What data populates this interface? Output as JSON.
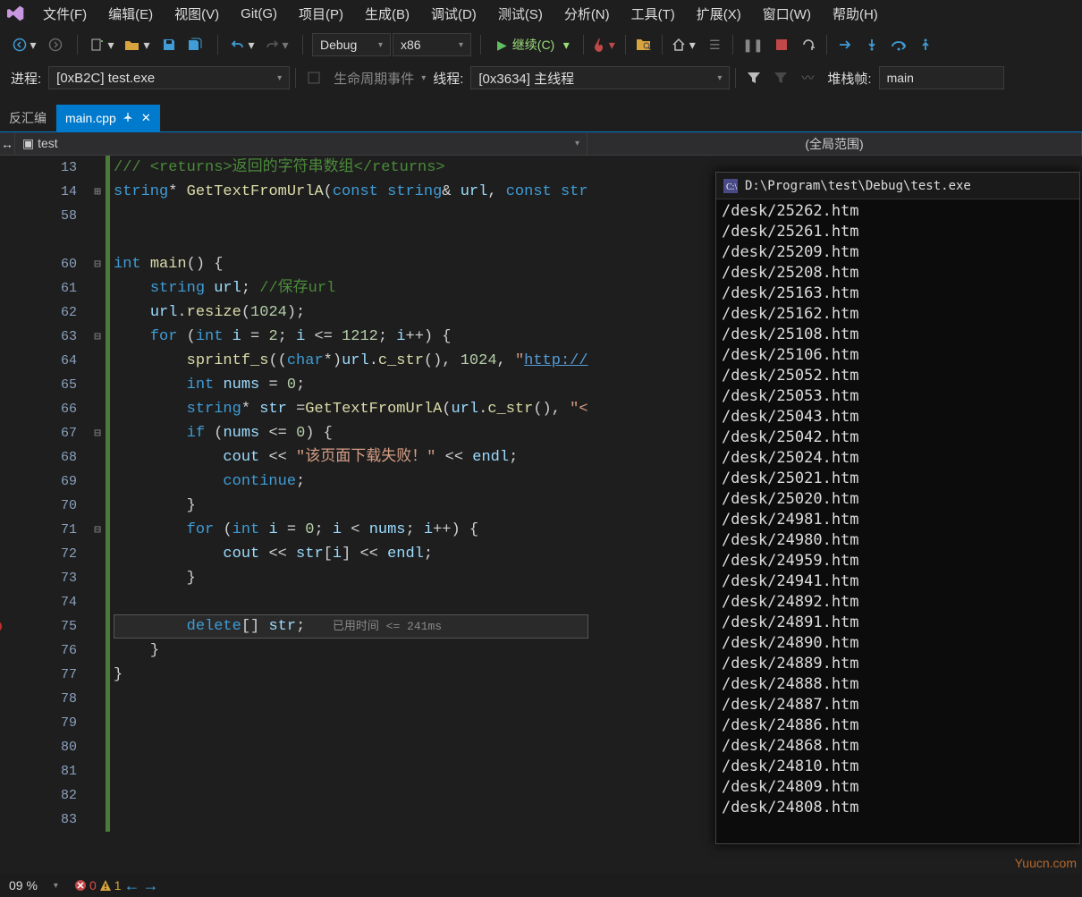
{
  "menu": {
    "items": [
      "文件(F)",
      "编辑(E)",
      "视图(V)",
      "Git(G)",
      "项目(P)",
      "生成(B)",
      "调试(D)",
      "测试(S)",
      "分析(N)",
      "工具(T)",
      "扩展(X)",
      "窗口(W)",
      "帮助(H)"
    ]
  },
  "toolbar1": {
    "config_combo": "Debug",
    "platform_combo": "x86",
    "continue_label": "继续(C)"
  },
  "toolbar2": {
    "process_label": "进程:",
    "process_value": "[0xB2C] test.exe",
    "lifecycle_label": "生命周期事件",
    "thread_label": "线程:",
    "thread_value": "[0x3634] 主线程",
    "stackframe_label": "堆栈帧:",
    "stackframe_value": "main"
  },
  "tabs": {
    "items": [
      {
        "label": "反汇编",
        "active": false
      },
      {
        "label": "main.cpp",
        "active": true
      }
    ]
  },
  "scope": {
    "project_combo": "test",
    "scope_combo": "(全局范围)"
  },
  "code": {
    "lines": [
      {
        "n": 13,
        "fold": "",
        "html": "<span class='c-cm'>/// &lt;returns&gt;返回的字符串数组&lt;/returns&gt;</span>"
      },
      {
        "n": 14,
        "fold": "+",
        "html": "<span class='c-ty'>string</span><span class='c-op'>* </span><span class='c-fn'>GetTextFromUrlA</span><span class='c-op'>(</span><span class='c-kw'>const</span> <span class='c-ty'>string</span><span class='c-op'>&amp; </span><span class='c-id'>url</span><span class='c-op'>, </span><span class='c-kw'>const</span> <span class='c-ty'>str</span>"
      },
      {
        "n": 58,
        "fold": "",
        "html": ""
      },
      {
        "n": "",
        "fold": "",
        "html": ""
      },
      {
        "n": 60,
        "fold": "-",
        "html": "<span class='c-kw'>int</span> <span class='c-fn'>main</span><span class='c-op'>() {</span>"
      },
      {
        "n": 61,
        "fold": "",
        "html": "    <span class='c-ty'>string</span> <span class='c-id'>url</span><span class='c-op'>;</span> <span class='c-cm'>//保存url</span>"
      },
      {
        "n": 62,
        "fold": "",
        "html": "    <span class='c-id'>url</span><span class='c-op'>.</span><span class='c-fn'>resize</span><span class='c-op'>(</span><span class='c-num'>1024</span><span class='c-op'>);</span>"
      },
      {
        "n": 63,
        "fold": "-",
        "html": "    <span class='c-kw'>for</span> <span class='c-op'>(</span><span class='c-kw'>int</span> <span class='c-id'>i</span> <span class='c-op'>=</span> <span class='c-num'>2</span><span class='c-op'>; </span><span class='c-id'>i</span> <span class='c-op'>&lt;=</span> <span class='c-num'>1212</span><span class='c-op'>; </span><span class='c-id'>i</span><span class='c-op'>++) {</span>"
      },
      {
        "n": 64,
        "fold": "",
        "html": "        <span class='c-fn'>sprintf_s</span><span class='c-op'>((</span><span class='c-kw'>char</span><span class='c-op'>*)</span><span class='c-id'>url</span><span class='c-op'>.</span><span class='c-fn'>c_str</span><span class='c-op'>(), </span><span class='c-num'>1024</span><span class='c-op'>, </span><span class='c-str'>\"</span><span class='c-url'>http://</span>"
      },
      {
        "n": 65,
        "fold": "",
        "html": "        <span class='c-kw'>int</span> <span class='c-id'>nums</span> <span class='c-op'>=</span> <span class='c-num'>0</span><span class='c-op'>;</span>"
      },
      {
        "n": 66,
        "fold": "",
        "html": "        <span class='c-ty'>string</span><span class='c-op'>* </span><span class='c-id'>str</span> <span class='c-op'>=</span><span class='c-fn'>GetTextFromUrlA</span><span class='c-op'>(</span><span class='c-id'>url</span><span class='c-op'>.</span><span class='c-fn'>c_str</span><span class='c-op'>(), </span><span class='c-str'>\"&lt;</span>"
      },
      {
        "n": 67,
        "fold": "-",
        "html": "        <span class='c-kw'>if</span> <span class='c-op'>(</span><span class='c-id'>nums</span> <span class='c-op'>&lt;=</span> <span class='c-num'>0</span><span class='c-op'>) {</span>"
      },
      {
        "n": 68,
        "fold": "",
        "html": "            <span class='c-id'>cout</span> <span class='c-op'>&lt;&lt;</span> <span class='c-str'>\"该页面下载失败！\"</span> <span class='c-op'>&lt;&lt;</span> <span class='c-id'>endl</span><span class='c-op'>;</span>"
      },
      {
        "n": 69,
        "fold": "",
        "html": "            <span class='c-kw'>continue</span><span class='c-op'>;</span>"
      },
      {
        "n": 70,
        "fold": "",
        "html": "        <span class='c-op'>}</span>"
      },
      {
        "n": 71,
        "fold": "-",
        "html": "        <span class='c-kw'>for</span> <span class='c-op'>(</span><span class='c-kw'>int</span> <span class='c-id'>i</span> <span class='c-op'>=</span> <span class='c-num'>0</span><span class='c-op'>; </span><span class='c-id'>i</span> <span class='c-op'>&lt;</span> <span class='c-id'>nums</span><span class='c-op'>; </span><span class='c-id'>i</span><span class='c-op'>++) {</span>"
      },
      {
        "n": 72,
        "fold": "",
        "html": "            <span class='c-id'>cout</span> <span class='c-op'>&lt;&lt;</span> <span class='c-id'>str</span><span class='c-op'>[</span><span class='c-id'>i</span><span class='c-op'>] &lt;&lt;</span> <span class='c-id'>endl</span><span class='c-op'>;</span>"
      },
      {
        "n": 73,
        "fold": "",
        "html": "        <span class='c-op'>}</span>"
      },
      {
        "n": 74,
        "fold": "",
        "html": ""
      },
      {
        "n": 75,
        "fold": "",
        "exec": true,
        "html": "        <span class='c-kw'>delete</span><span class='c-op'>[]</span> <span class='c-id'>str</span><span class='c-op'>;</span>   <span class='perf'>已用时间 &lt;= 241ms</span>"
      },
      {
        "n": 76,
        "fold": "",
        "html": "    <span class='c-op'>}</span>"
      },
      {
        "n": 77,
        "fold": "",
        "html": "<span class='c-op'>}</span>"
      },
      {
        "n": 78,
        "fold": "",
        "html": ""
      },
      {
        "n": 79,
        "fold": "",
        "html": ""
      },
      {
        "n": 80,
        "fold": "",
        "html": ""
      },
      {
        "n": 81,
        "fold": "",
        "html": ""
      },
      {
        "n": 82,
        "fold": "",
        "html": ""
      },
      {
        "n": 83,
        "fold": "",
        "html": ""
      }
    ]
  },
  "console": {
    "title": "D:\\Program\\test\\Debug\\test.exe",
    "lines": [
      "/desk/25262.htm",
      "/desk/25261.htm",
      "/desk/25209.htm",
      "/desk/25208.htm",
      "/desk/25163.htm",
      "/desk/25162.htm",
      "/desk/25108.htm",
      "/desk/25106.htm",
      "/desk/25052.htm",
      "/desk/25053.htm",
      "/desk/25043.htm",
      "/desk/25042.htm",
      "/desk/25024.htm",
      "/desk/25021.htm",
      "/desk/25020.htm",
      "/desk/24981.htm",
      "/desk/24980.htm",
      "/desk/24959.htm",
      "/desk/24941.htm",
      "/desk/24892.htm",
      "/desk/24891.htm",
      "/desk/24890.htm",
      "/desk/24889.htm",
      "/desk/24888.htm",
      "/desk/24887.htm",
      "/desk/24886.htm",
      "/desk/24868.htm",
      "/desk/24810.htm",
      "/desk/24809.htm",
      "/desk/24808.htm"
    ]
  },
  "status": {
    "zoom": "09 %",
    "errors": "0",
    "warnings": "1"
  },
  "watermark": "Yuucn.com"
}
